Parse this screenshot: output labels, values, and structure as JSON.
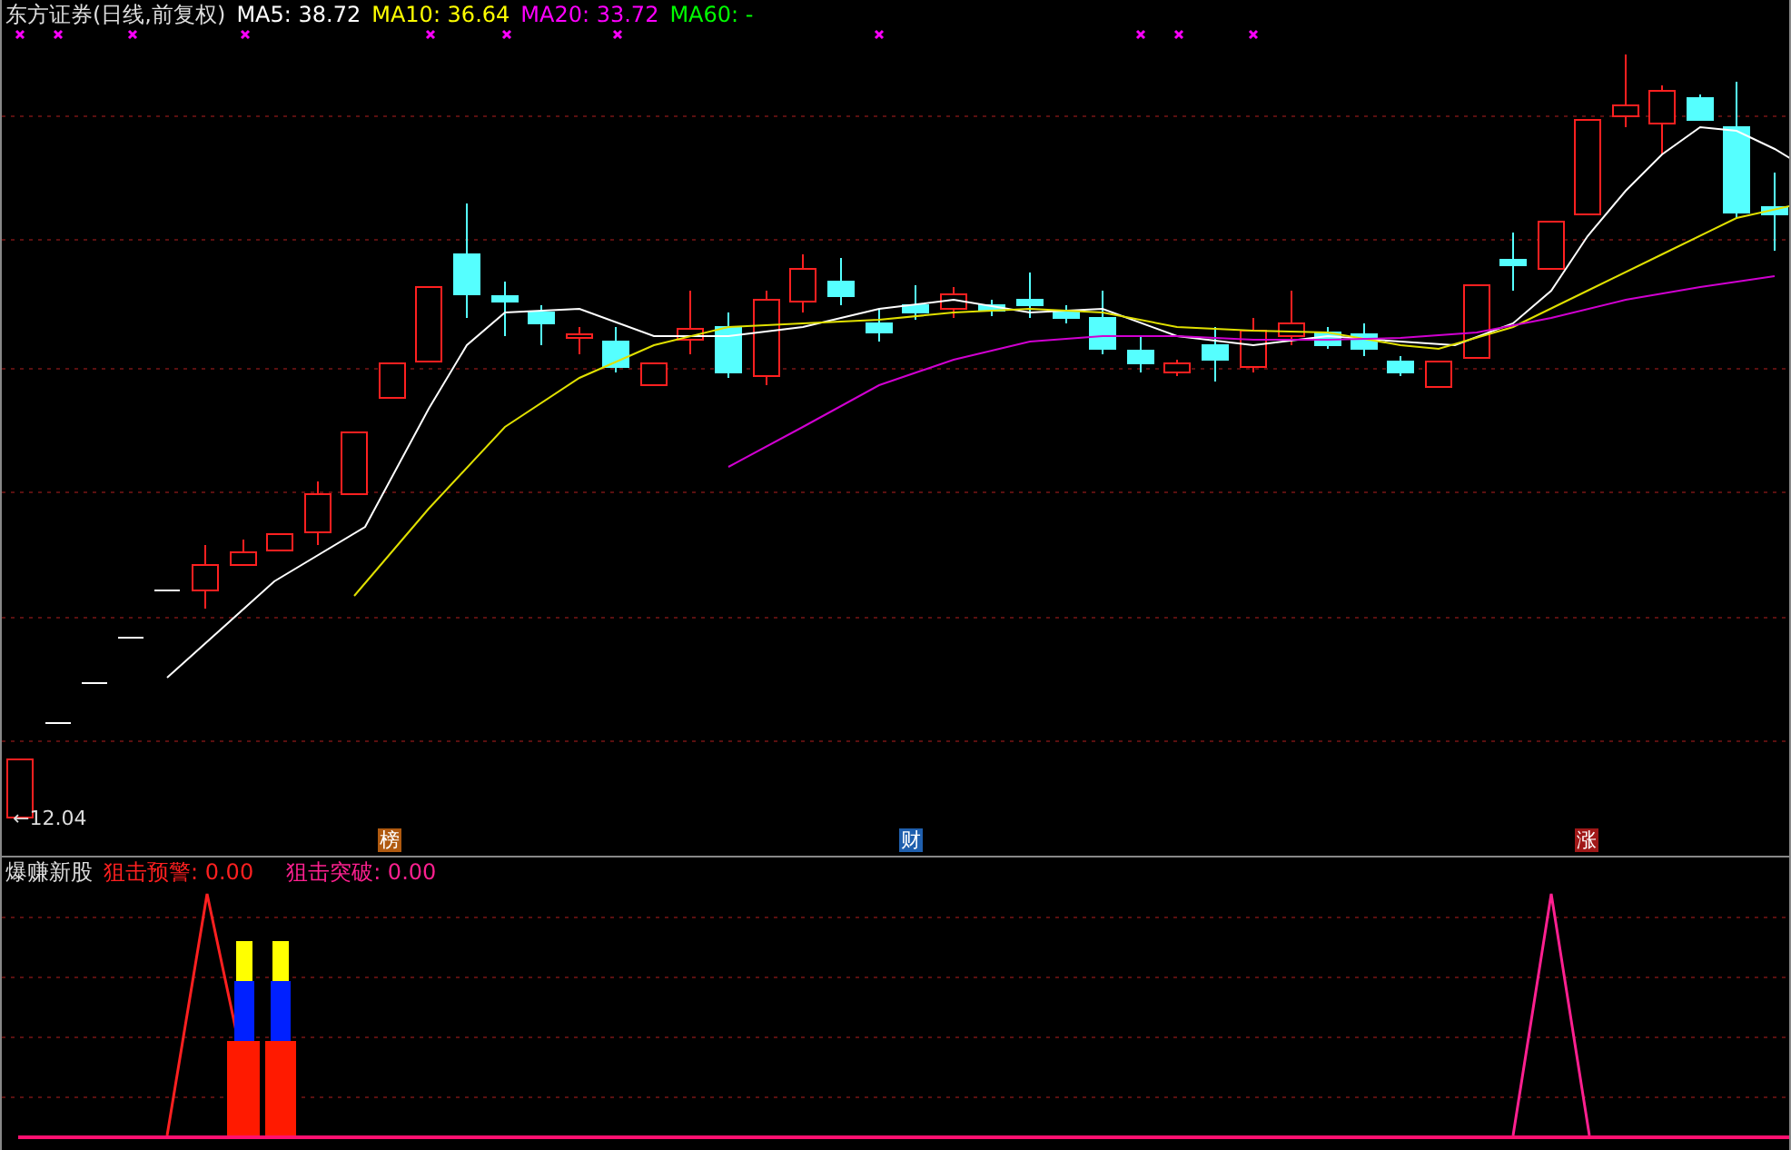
{
  "main_panel": {
    "title": "东方证券(日线,前复权)",
    "indicators": [
      {
        "label": "MA5: 38.72",
        "color": "#ffffff"
      },
      {
        "label": "MA10: 36.64",
        "color": "#ffff00"
      },
      {
        "label": "MA20: 33.72",
        "color": "#ff00ff"
      },
      {
        "label": "MA60: -",
        "color": "#00ff00"
      }
    ],
    "price_marker": "←12.04",
    "event_badges": [
      {
        "label": "榜",
        "color": "#b05a10"
      },
      {
        "label": "财",
        "color": "#1f5fae"
      },
      {
        "label": "涨",
        "color": "#a01818"
      }
    ]
  },
  "sub_panel": {
    "title": "爆赚新股",
    "indicators": [
      {
        "label": "狙击预警: 0.00",
        "color": "#ff2020"
      },
      {
        "label": "狙击突破: 0.00",
        "color": "#ff2090"
      }
    ]
  }
}
